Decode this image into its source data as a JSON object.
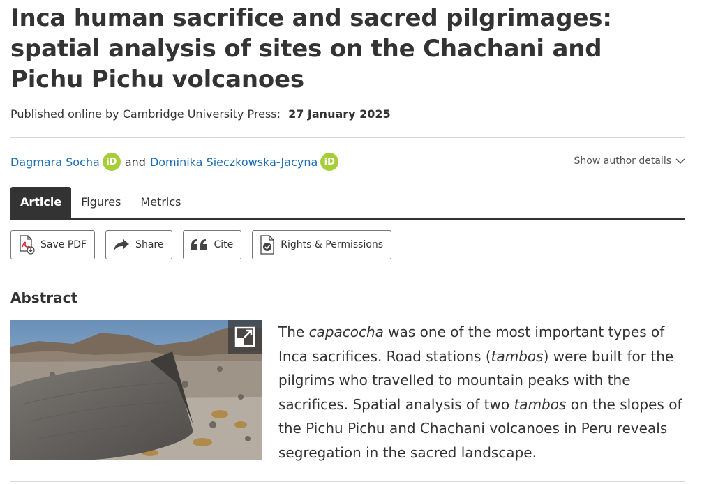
{
  "article": {
    "title": "Inca human sacrifice and sacred pilgrimages: spatial analysis of sites on the Chachani and Pichu Pichu volcanoes",
    "published_label": "Published online by Cambridge University Press:",
    "published_date": "27 January 2025"
  },
  "authors": {
    "items": [
      {
        "name": "Dagmara Socha",
        "orcid_label": "iD"
      },
      {
        "name": "Dominika Sieczkowska-Jacyna",
        "orcid_label": "iD"
      }
    ],
    "conjunction": "and",
    "show_details_label": "Show author details"
  },
  "tabs": [
    {
      "label": "Article",
      "active": true
    },
    {
      "label": "Figures",
      "active": false
    },
    {
      "label": "Metrics",
      "active": false
    }
  ],
  "actions": {
    "save_pdf": "Save PDF",
    "share": "Share",
    "cite": "Cite",
    "rights": "Rights & Permissions"
  },
  "abstract": {
    "heading": "Abstract",
    "segments": [
      {
        "text": "The ",
        "italic": false
      },
      {
        "text": "capacocha",
        "italic": true
      },
      {
        "text": " was one of the most important types of Inca sacrifices. Road stations (",
        "italic": false
      },
      {
        "text": "tambos",
        "italic": true
      },
      {
        "text": ") were built for the pilgrims who travelled to mountain peaks with the sacrifices. Spatial analysis of two ",
        "italic": false
      },
      {
        "text": "tambos",
        "italic": true
      },
      {
        "text": " on the slopes of the Pichu Pichu and Chachani volcanoes in Peru reveals segregation in the sacred landscape.",
        "italic": false
      }
    ]
  },
  "colors": {
    "link": "#1a6db3",
    "orcid": "#a6ce39",
    "tab_active_bg": "#333333",
    "text": "#333333"
  },
  "icons": [
    "orcid-icon",
    "chevron-down-icon",
    "pdf-icon",
    "share-icon",
    "quote-icon",
    "rights-icon",
    "expand-icon"
  ]
}
